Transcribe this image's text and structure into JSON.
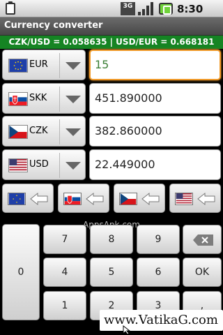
{
  "status_bar": {
    "network": "3G",
    "time": "8:30 PM",
    "icons": [
      "clipboard-icon",
      "3g-icon",
      "signal-icon",
      "battery-icon"
    ]
  },
  "app": {
    "title": "Currency converter"
  },
  "rates": {
    "text": "CZK/USD = 0.058635 | USD/EUR = 0.668181"
  },
  "rows": [
    {
      "code": "EUR",
      "flag": "eu-flag-icon",
      "value": "15"
    },
    {
      "code": "SKK",
      "flag": "sk-flag-icon",
      "value": "451.890000"
    },
    {
      "code": "CZK",
      "flag": "cz-flag-icon",
      "value": "382.860000"
    },
    {
      "code": "USD",
      "flag": "us-flag-icon",
      "value": "22.449000"
    }
  ],
  "watermark": "AppsApk.com",
  "keypad": {
    "zero": "0",
    "keys": [
      "7",
      "8",
      "9",
      "4",
      "5",
      "6",
      "1",
      "2",
      "3"
    ],
    "ok": "OK",
    "comma": ",",
    "backspace_icon": "backspace-icon"
  },
  "banner": "www.VatikaG.com",
  "colors": {
    "rate_bar": "#158423",
    "focus": "#f09a2a",
    "title_bar": "#5a5a5a"
  }
}
